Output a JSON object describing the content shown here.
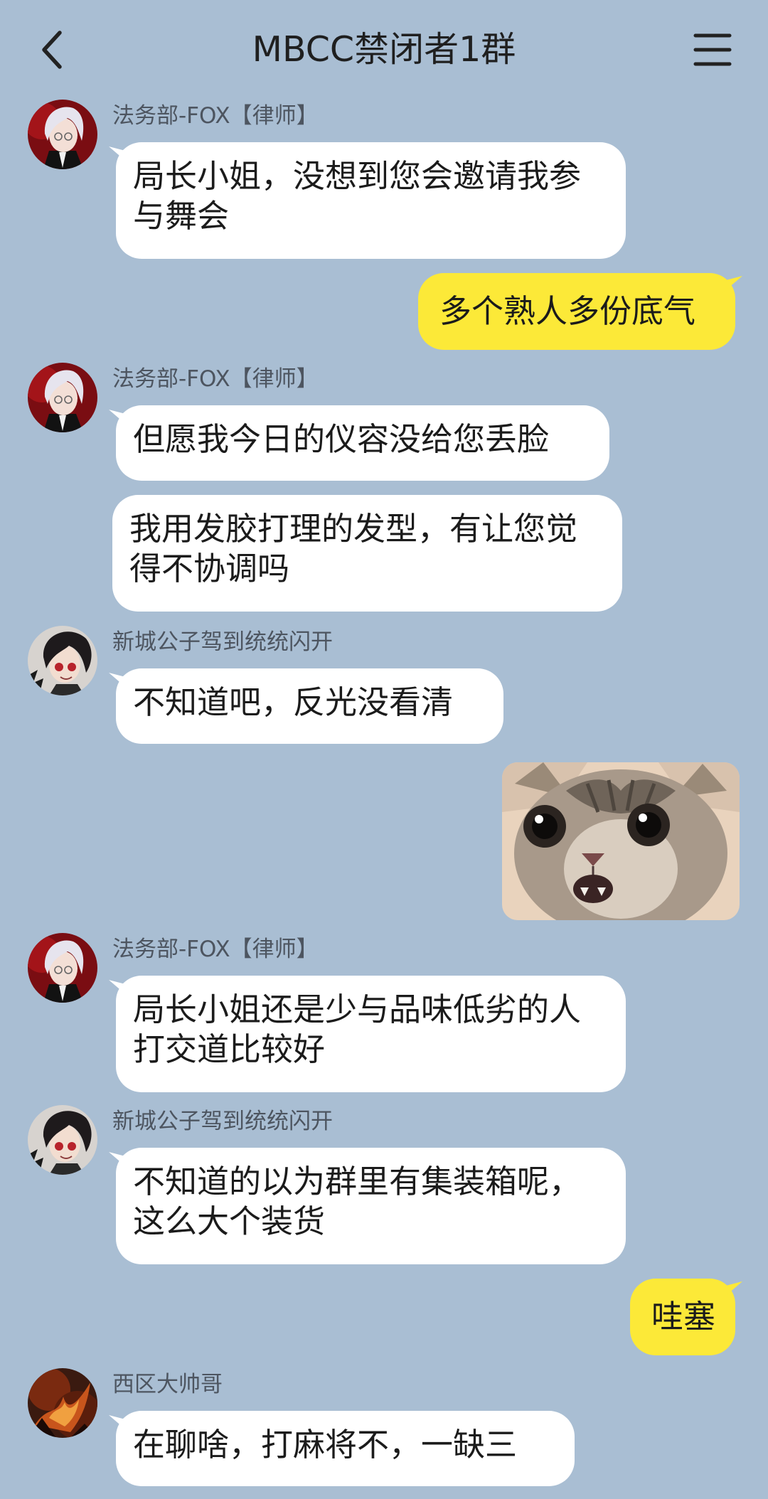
{
  "header": {
    "title": "MBCC禁闭者1群",
    "back_icon": "chevron-left-icon",
    "menu_icon": "menu-icon"
  },
  "colors": {
    "background": "#A9BED3",
    "incoming_bubble": "#FFFFFF",
    "outgoing_bubble": "#FCE938"
  },
  "messages": [
    {
      "sender": "法务部-FOX【律师】",
      "direction": "in",
      "text": "局长小姐，没想到您会邀请我参与舞会"
    },
    {
      "direction": "out",
      "text": "多个熟人多份底气"
    },
    {
      "sender": "法务部-FOX【律师】",
      "direction": "in",
      "text": "但愿我今日的仪容没给您丢脸"
    },
    {
      "direction": "in",
      "text": "我用发胶打理的发型，有让您觉得不协调吗"
    },
    {
      "sender": "新城公子驾到统统闪开",
      "direction": "in",
      "text": "不知道吧，反光没看清"
    },
    {
      "direction": "out",
      "type": "sticker",
      "sticker": "surprised-cat-sticker"
    },
    {
      "sender": "法务部-FOX【律师】",
      "direction": "in",
      "text": "局长小姐还是少与品味低劣的人打交道比较好"
    },
    {
      "sender": "新城公子驾到统统闪开",
      "direction": "in",
      "text": "不知道的以为群里有集装箱呢，这么大个装货"
    },
    {
      "direction": "out",
      "text": "哇塞"
    },
    {
      "sender": "西区大帅哥",
      "direction": "in",
      "text": "在聊啥，打麻将不，一缺三"
    }
  ]
}
